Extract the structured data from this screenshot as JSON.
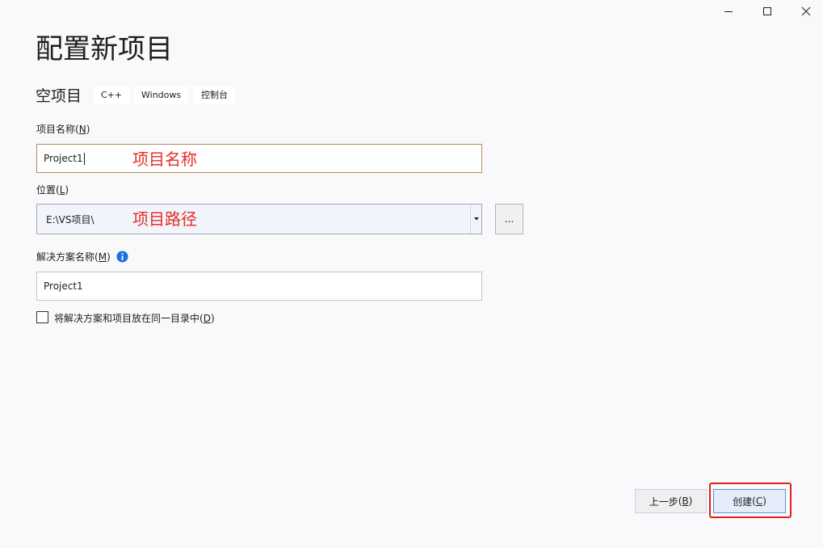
{
  "window": {
    "controls": [
      {
        "name": "minimize",
        "icon": "minimize-icon"
      },
      {
        "name": "maximize",
        "icon": "maximize-icon"
      },
      {
        "name": "close",
        "icon": "close-icon"
      }
    ]
  },
  "title": "配置新项目",
  "template": {
    "name": "空项目",
    "tags": [
      "C++",
      "Windows",
      "控制台"
    ]
  },
  "project_name": {
    "label": "项目名称",
    "access_key": "N",
    "value": "Project1",
    "annotation": "项目名称"
  },
  "location": {
    "label": "位置",
    "access_key": "L",
    "value": "E:\\VS项目\\",
    "annotation": "项目路径",
    "browse_label": "..."
  },
  "solution_name": {
    "label": "解决方案名称",
    "access_key": "M",
    "value": "Project1",
    "info_icon": "info-icon"
  },
  "same_directory": {
    "label": "将解决方案和项目放在同一目录中",
    "access_key": "D",
    "checked": false
  },
  "buttons": {
    "back": {
      "label": "上一步",
      "access_key": "B"
    },
    "create": {
      "label": "创建",
      "access_key": "C"
    }
  },
  "colors": {
    "background": "#f9f9fb",
    "annotation": "#e52e26",
    "highlight_box": "#e0211b",
    "focus_border": "#ad8b5c",
    "info": "#1a73d9"
  }
}
